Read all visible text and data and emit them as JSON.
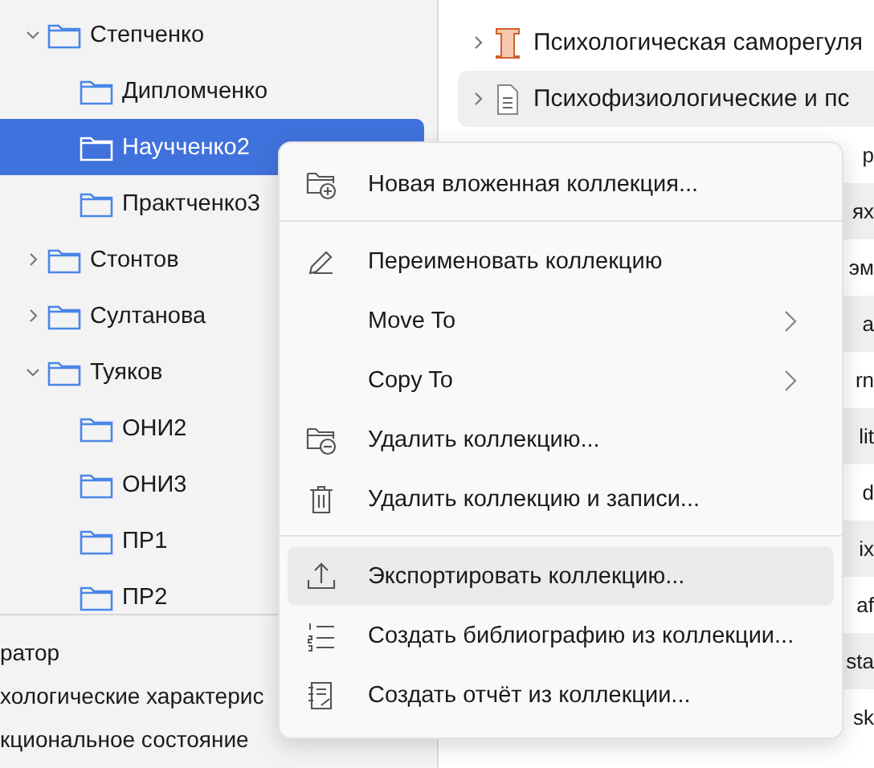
{
  "tree": [
    {
      "label": "Степченко",
      "expanded": true,
      "selected": false,
      "children": [
        {
          "label": "Дипломченко",
          "selected": false
        },
        {
          "label": "Научченко2",
          "selected": true
        },
        {
          "label": "Практченко3",
          "selected": false
        }
      ]
    },
    {
      "label": "Стонтов",
      "expanded": false,
      "selected": false
    },
    {
      "label": "Султанова",
      "expanded": false,
      "selected": false
    },
    {
      "label": "Туяков",
      "expanded": true,
      "selected": false,
      "children": [
        {
          "label": "ОНИ2",
          "selected": false
        },
        {
          "label": "ОНИ3",
          "selected": false
        },
        {
          "label": "ПР1",
          "selected": false
        },
        {
          "label": "ПР2",
          "selected": false
        }
      ]
    }
  ],
  "tags": [
    "ратор",
    "хологические характерис",
    "кциональное состояние"
  ],
  "items": [
    {
      "kind": "item",
      "title": "Психологическая саморегуля"
    },
    {
      "kind": "item",
      "title": "Психофизиологические и пс"
    },
    {
      "kind": "fragment",
      "title": "р"
    },
    {
      "kind": "fragment",
      "title": "ях"
    },
    {
      "kind": "fragment",
      "title": "эм"
    },
    {
      "kind": "fragment",
      "title": "a"
    },
    {
      "kind": "fragment",
      "title": "rn"
    },
    {
      "kind": "fragment",
      "title": "lit"
    },
    {
      "kind": "fragment",
      "title": "d"
    },
    {
      "kind": "fragment",
      "title": "ix"
    },
    {
      "kind": "fragment",
      "title": "af"
    },
    {
      "kind": "fragment",
      "title": "sta"
    },
    {
      "kind": "fragment",
      "title": "sk"
    }
  ],
  "menu": [
    {
      "kind": "item",
      "label": "Новая вложенная коллекция...",
      "selected": false
    },
    {
      "kind": "separator"
    },
    {
      "kind": "item",
      "label": "Переименовать коллекцию",
      "selected": false
    },
    {
      "kind": "submenu",
      "label": "Move To",
      "selected": false
    },
    {
      "kind": "submenu",
      "label": "Copy To",
      "selected": false
    },
    {
      "kind": "item",
      "label": "Удалить коллекцию...",
      "selected": false
    },
    {
      "kind": "item",
      "label": "Удалить коллекцию и записи...",
      "selected": false
    },
    {
      "kind": "separator"
    },
    {
      "kind": "item",
      "label": "Экспортировать коллекцию...",
      "selected": true
    },
    {
      "kind": "item",
      "label": "Создать библиографию из коллекции...",
      "selected": false
    },
    {
      "kind": "item",
      "label": "Создать отчёт из коллекции...",
      "selected": false
    }
  ]
}
